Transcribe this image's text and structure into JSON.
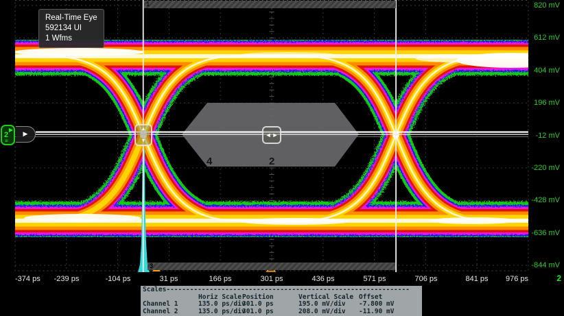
{
  "info_box": {
    "mode": "Real-Time Eye",
    "ui_count": "592134 UI",
    "waveforms": "1 Wfms"
  },
  "axes": {
    "y_labels": [
      "820 mV",
      "612 mV",
      "404 mV",
      "196 mV",
      "-12 mV",
      "-220 mV",
      "-428 mV",
      "-636 mV",
      "-844 mV"
    ],
    "x_labels": [
      "-374 ps",
      "-239 ps",
      "-104 ps",
      "31 ps",
      "166 ps",
      "301 ps",
      "436 ps",
      "571 ps",
      "706 ps",
      "841 ps",
      "976 ps"
    ],
    "channel_indicator": "2"
  },
  "markers": {
    "top_gate_label": "1",
    "bottom_gate_label": "3",
    "mask_label_left": "4",
    "mask_label_center": "2",
    "channel_badge": "2",
    "up_arrow": "▲",
    "down_arrow": "▼",
    "left_arrow": "◄",
    "right_arrow": "►",
    "tab_arrow": "▶",
    "badge_arrow": "▶",
    "badge_lines": "≡"
  },
  "scales_table": {
    "title": "Scales",
    "title_dashes": "--------------------------------------------------------------",
    "col_headers": [
      "Horiz Scale",
      "Position",
      "Vertical Scale",
      "Offset"
    ],
    "rows": [
      {
        "channel": "Channel 1",
        "horiz_scale": "135.0 ps/div",
        "position": "301.0 ps",
        "vertical_scale": "195.0 mV/div",
        "offset": "-7.800 mV"
      },
      {
        "channel": "Channel 2",
        "horiz_scale": "135.0 ps/div",
        "position": "301.0 ps",
        "vertical_scale": "208.0 mV/div",
        "offset": "-11.90 mV"
      }
    ]
  },
  "colors": {
    "accent_green": "#2ee62e",
    "trace_palette": [
      "#17c817",
      "#1d1de0",
      "#e818e8",
      "#e01400",
      "#ff8c00",
      "#ffd400",
      "#ffffff"
    ],
    "histogram_cyan": "#35d6d6",
    "marker_orange": "#ffa000",
    "mask_gray": "#67676a"
  }
}
